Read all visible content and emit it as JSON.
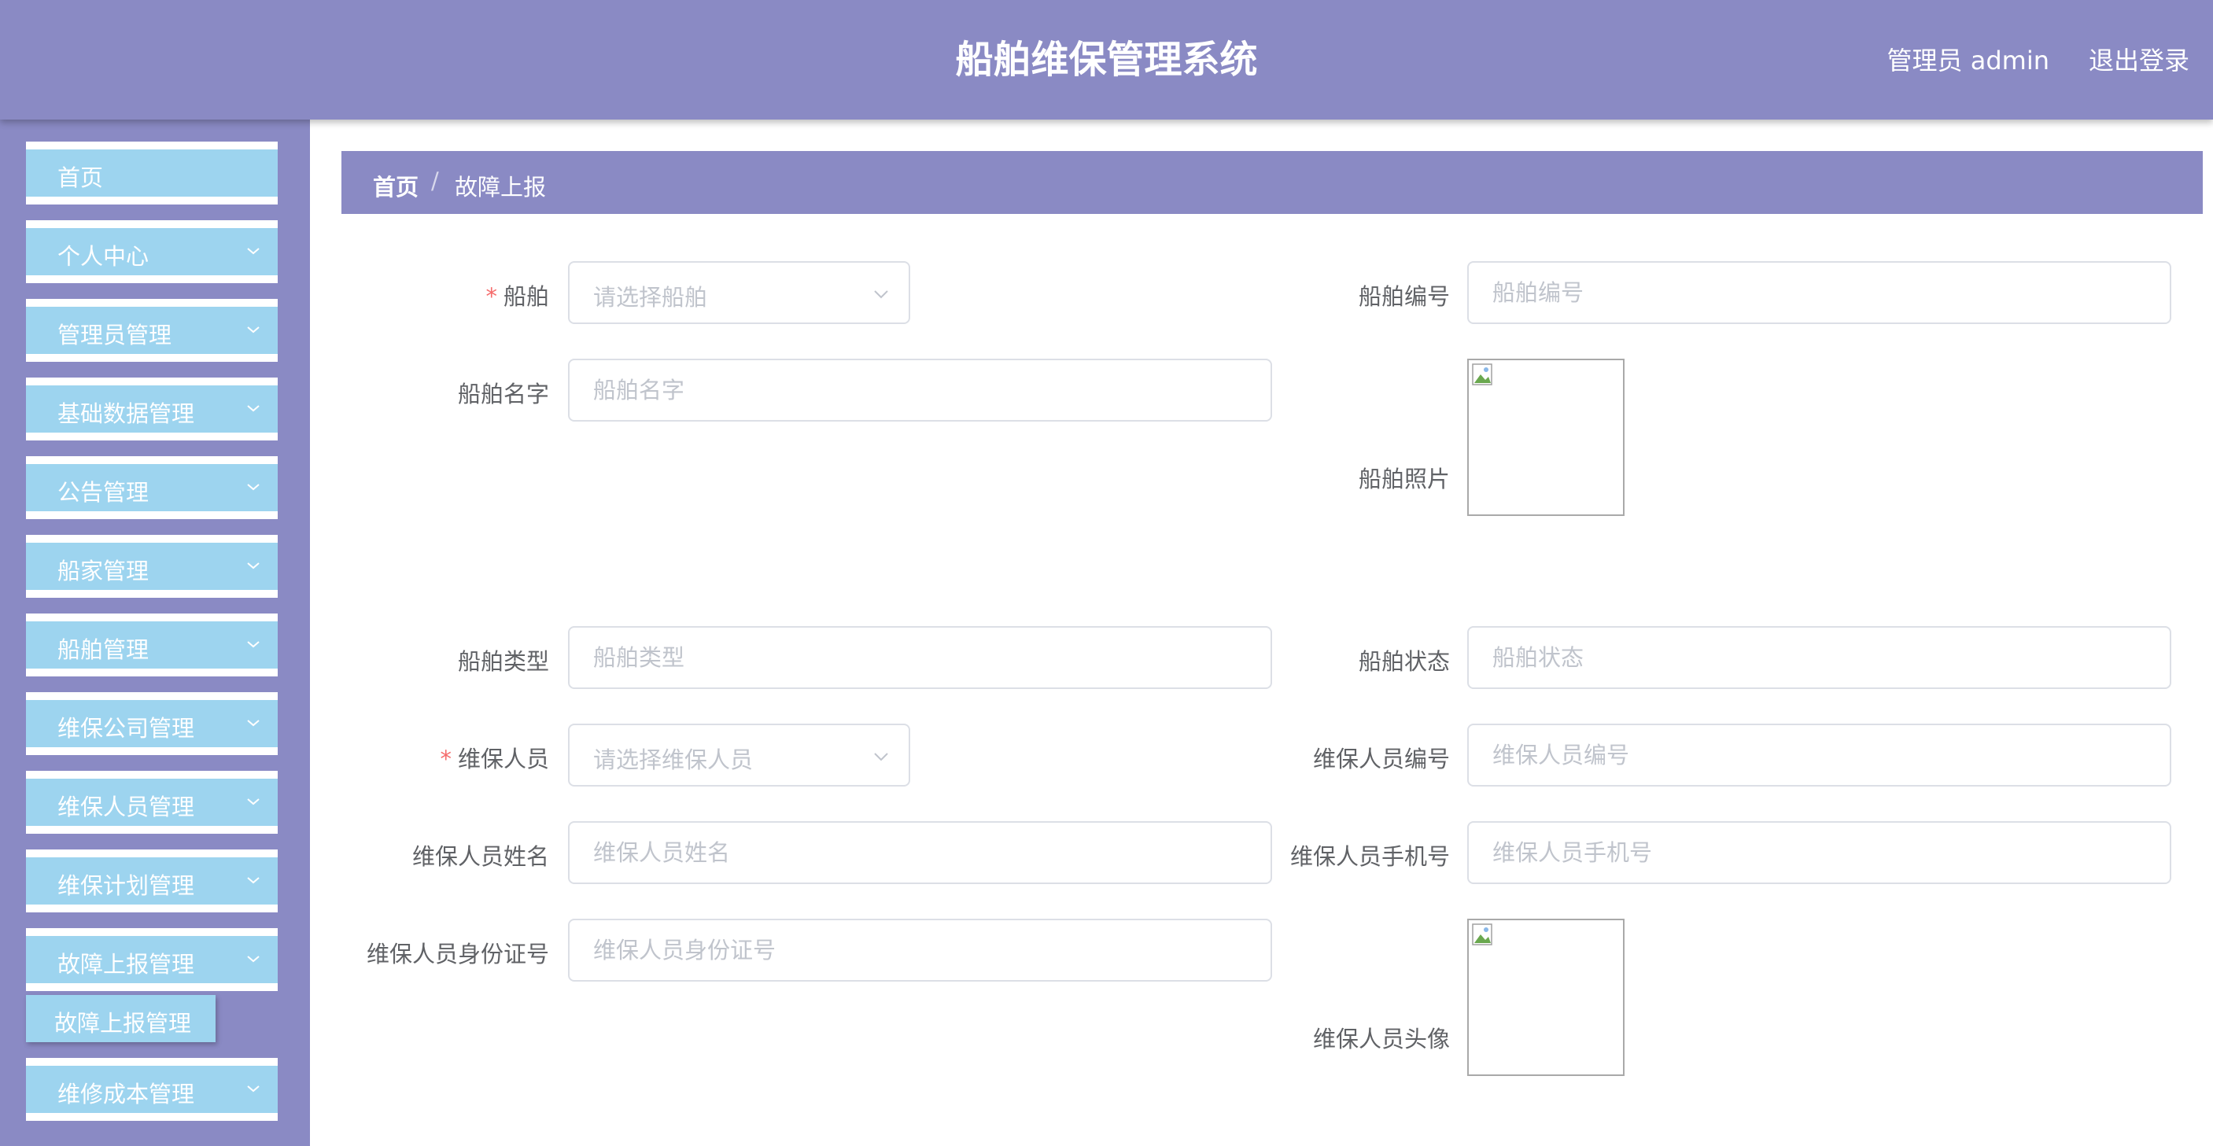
{
  "header": {
    "title": "船舶维保管理系统",
    "user": "管理员 admin",
    "logout": "退出登录"
  },
  "sidebar": {
    "items": [
      {
        "label": "首页"
      },
      {
        "label": "个人中心"
      },
      {
        "label": "管理员管理"
      },
      {
        "label": "基础数据管理"
      },
      {
        "label": "公告管理"
      },
      {
        "label": "船家管理"
      },
      {
        "label": "船舶管理"
      },
      {
        "label": "维保公司管理"
      },
      {
        "label": "维保人员管理"
      },
      {
        "label": "维保计划管理"
      },
      {
        "label": "故障上报管理"
      },
      {
        "label": "维修成本管理"
      }
    ],
    "submenu": {
      "label": "故障上报管理"
    }
  },
  "breadcrumb": {
    "home": "首页",
    "separator": "/",
    "current": "故障上报"
  },
  "form": {
    "ship": {
      "label": "船舶",
      "placeholder": "请选择船舶"
    },
    "ship_no": {
      "label": "船舶编号",
      "placeholder": "船舶编号"
    },
    "ship_name": {
      "label": "船舶名字",
      "placeholder": "船舶名字"
    },
    "ship_photo": {
      "label": "船舶照片"
    },
    "ship_type": {
      "label": "船舶类型",
      "placeholder": "船舶类型"
    },
    "ship_status": {
      "label": "船舶状态",
      "placeholder": "船舶状态"
    },
    "staff": {
      "label": "维保人员",
      "placeholder": "请选择维保人员"
    },
    "staff_no": {
      "label": "维保人员编号",
      "placeholder": "维保人员编号"
    },
    "staff_name": {
      "label": "维保人员姓名",
      "placeholder": "维保人员姓名"
    },
    "staff_phone": {
      "label": "维保人员手机号",
      "placeholder": "维保人员手机号"
    },
    "staff_id": {
      "label": "维保人员身份证号",
      "placeholder": "维保人员身份证号"
    },
    "staff_avatar": {
      "label": "维保人员头像"
    }
  }
}
